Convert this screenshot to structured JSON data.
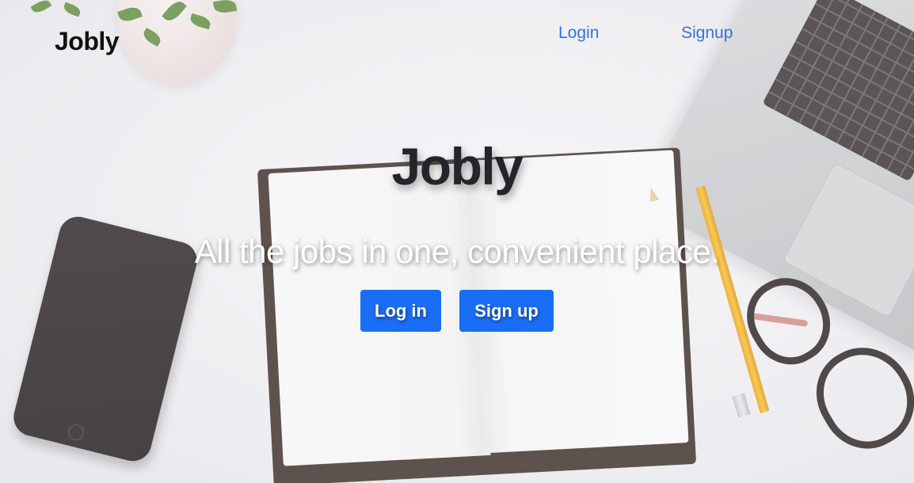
{
  "navbar": {
    "brand": "Jobly",
    "links": [
      {
        "label": "Login"
      },
      {
        "label": "Signup"
      }
    ],
    "link_color": "#2f74e0"
  },
  "hero": {
    "title": "Jobly",
    "subtitle": "All the jobs in one, convenient place.",
    "buttons": [
      {
        "label": "Log in"
      },
      {
        "label": "Sign up"
      }
    ],
    "button_color": "#1a6ef6"
  },
  "background": {
    "objects": [
      "plant-pot",
      "laptop",
      "phone",
      "open-notebook",
      "pencil",
      "glasses"
    ]
  }
}
